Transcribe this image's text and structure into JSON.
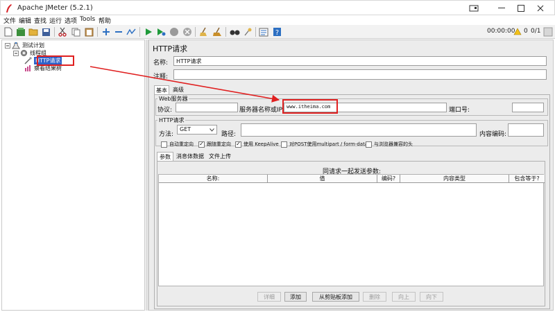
{
  "window": {
    "title": "Apache JMeter (5.2.1)"
  },
  "menu": [
    "文件",
    "编辑",
    "查找",
    "运行",
    "选项",
    "Tools",
    "帮助"
  ],
  "toolbar": {
    "timer": "00:00:00",
    "warning_count": "0",
    "threads": "0/1"
  },
  "tree": {
    "test_plan": "测试计划",
    "thread_group": "线程组",
    "http_request": "HTTP请求",
    "result_tree": "察看结果树"
  },
  "form": {
    "heading": "HTTP请求",
    "name_label": "名称:",
    "name_value": "HTTP请求",
    "comment_label": "注释:",
    "comment_value": "",
    "tabs": [
      "基本",
      "高级"
    ],
    "web_server": {
      "group_title": "Web服务器",
      "protocol_label": "协议:",
      "protocol_value": "",
      "server_label": "服务器名称或IP:",
      "server_value": "www.itheima.com",
      "port_label": "端口号:",
      "port_value": ""
    },
    "http_request": {
      "group_title": "HTTP请求",
      "method_label": "方法:",
      "method_value": "GET",
      "path_label": "路径:",
      "path_value": "",
      "encoding_label": "内容编码:",
      "encoding_value": ""
    },
    "checkboxes": [
      {
        "label": "自动重定向",
        "checked": false
      },
      {
        "label": "跟随重定向",
        "checked": true
      },
      {
        "label": "使用 KeepAlive",
        "checked": true
      },
      {
        "label": "对POST使用multipart / form-data",
        "checked": false
      },
      {
        "label": "与浏览器兼容的头",
        "checked": false
      }
    ],
    "sub_tabs": [
      "参数",
      "消息体数据",
      "文件上传"
    ],
    "params_caption": "同请求一起发送参数:",
    "columns": [
      "名称:",
      "值",
      "编码?",
      "内容类型",
      "包含等于?"
    ],
    "buttons": [
      {
        "label": "详细",
        "enabled": false
      },
      {
        "label": "添加",
        "enabled": true
      },
      {
        "label": "从剪贴板添加",
        "enabled": true
      },
      {
        "label": "删除",
        "enabled": false
      },
      {
        "label": "向上",
        "enabled": false
      },
      {
        "label": "向下",
        "enabled": false
      }
    ]
  },
  "colors": {
    "highlight": "#e02020",
    "selection": "#2f63c9",
    "play": "#1f9a3a"
  }
}
